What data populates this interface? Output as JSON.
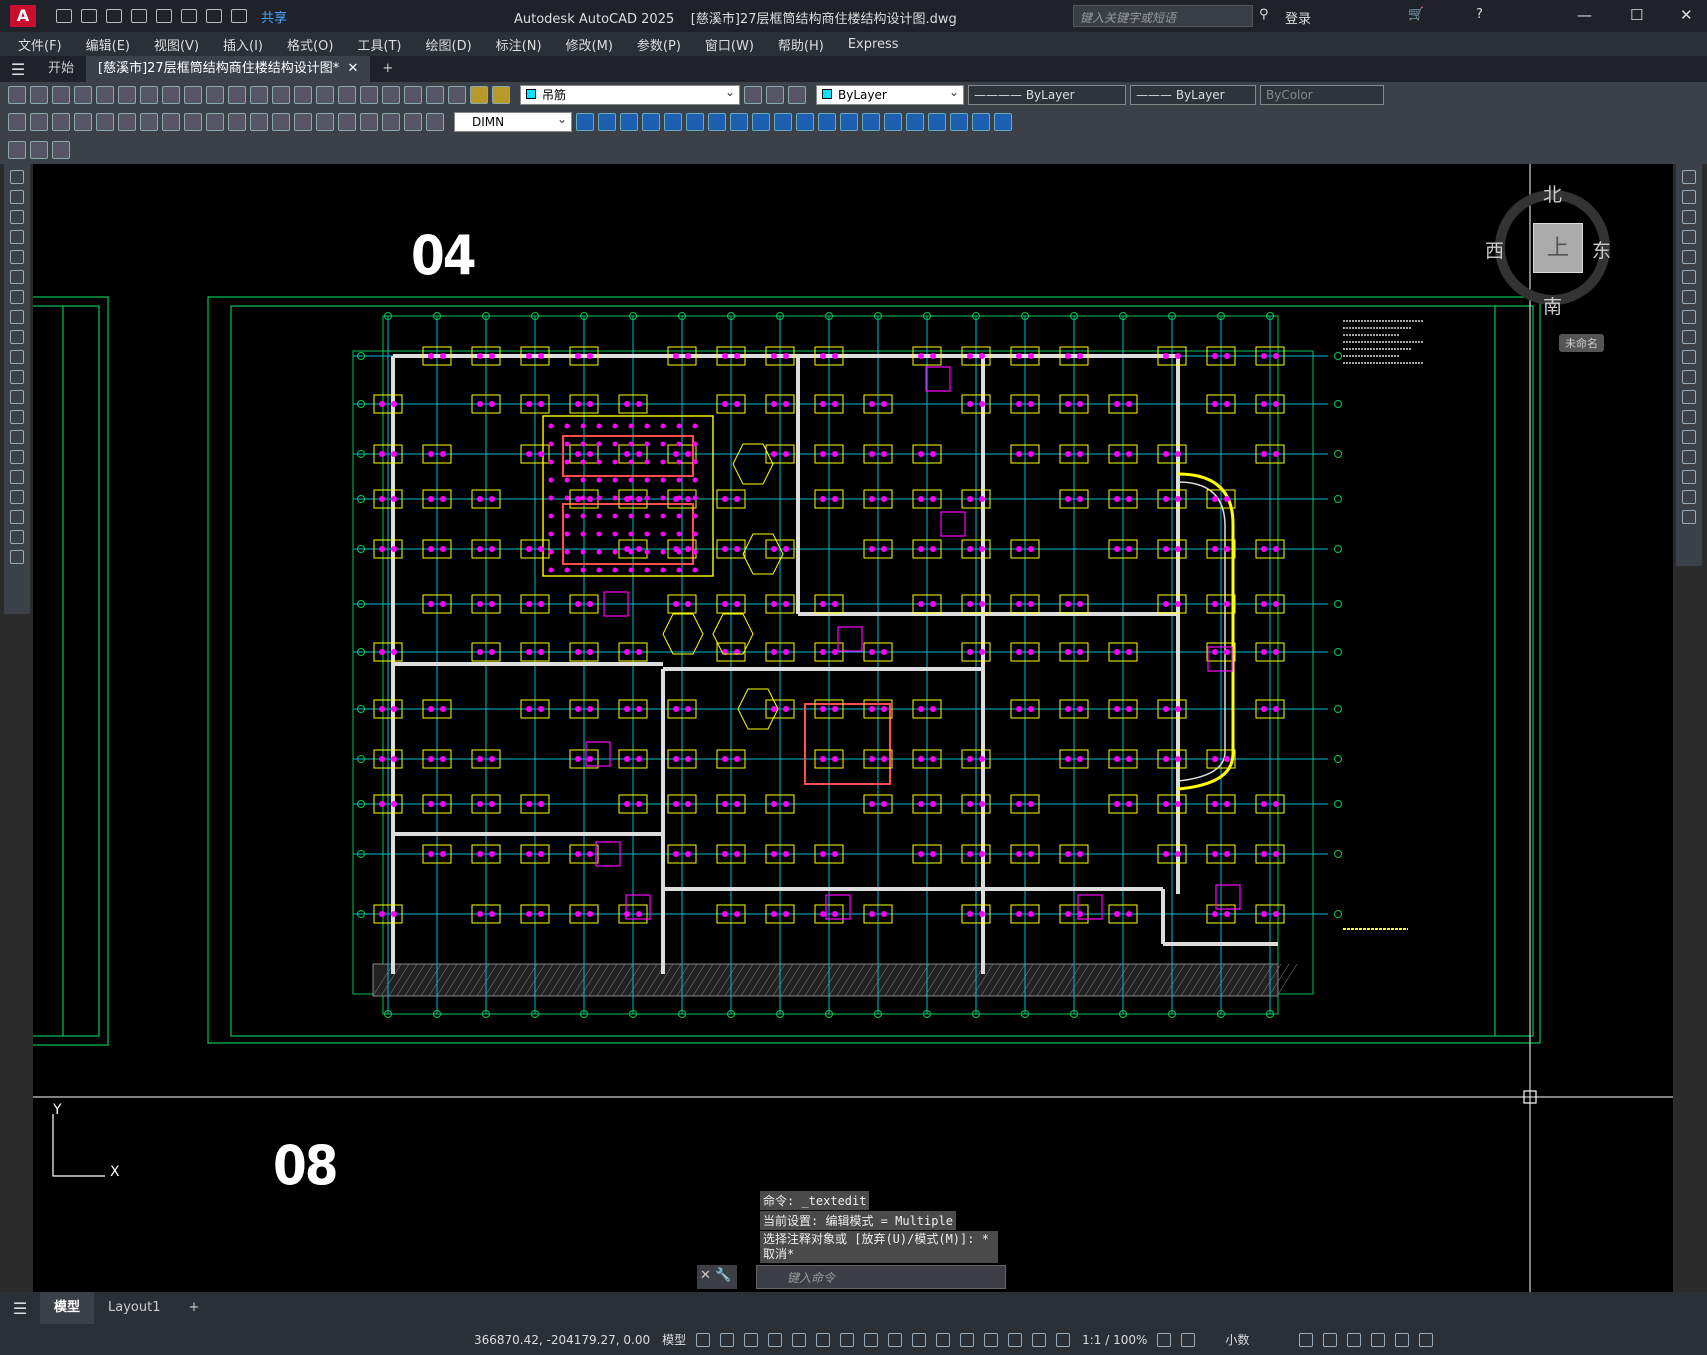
{
  "titlebar": {
    "logo": "A",
    "share": "共享",
    "app_title": "Autodesk AutoCAD 2025",
    "file_title": "[慈溪市]27层框筒结构商住楼结构设计图.dwg",
    "search_placeholder": "键入关键字或短语",
    "login": "登录"
  },
  "menu": [
    "文件(F)",
    "编辑(E)",
    "视图(V)",
    "插入(I)",
    "格式(O)",
    "工具(T)",
    "绘图(D)",
    "标注(N)",
    "修改(M)",
    "参数(P)",
    "窗口(W)",
    "帮助(H)",
    "Express"
  ],
  "tabs": {
    "start": "开始",
    "file": "[慈溪市]27层框筒结构商住楼结构设计图*",
    "add": "+"
  },
  "layer": {
    "name": "吊筋",
    "color_label": "ByLayer",
    "linetype": "ByLayer",
    "lineweight": "ByLayer",
    "plotstyle": "ByColor"
  },
  "dimstyle": "DIMN",
  "viewcube": {
    "north": "北",
    "south": "南",
    "east": "东",
    "west": "西",
    "top": "上",
    "wcs": "未命名"
  },
  "canvas_labels": {
    "top_view": "04",
    "bottom_view": "08",
    "axis_y": "Y",
    "axis_x": "X"
  },
  "command_history": [
    "命令: _textedit",
    "当前设置: 编辑模式 = Multiple",
    "选择注释对象或 [放弃(U)/模式(M)]: *取消*"
  ],
  "command_placeholder": "键入命令",
  "layout_tabs": {
    "model": "模型",
    "layout1": "Layout1"
  },
  "status": {
    "coords": "366870.42, -204179.27, 0.00",
    "mode": "模型",
    "scale": "1:1 / 100%",
    "units": "小数"
  },
  "colors": {
    "bg": "#000000",
    "grid": "#00c853",
    "beam": "#00bcd4",
    "column": "#ffff00",
    "pile": "#ff00ff",
    "wall": "#ffffff"
  }
}
